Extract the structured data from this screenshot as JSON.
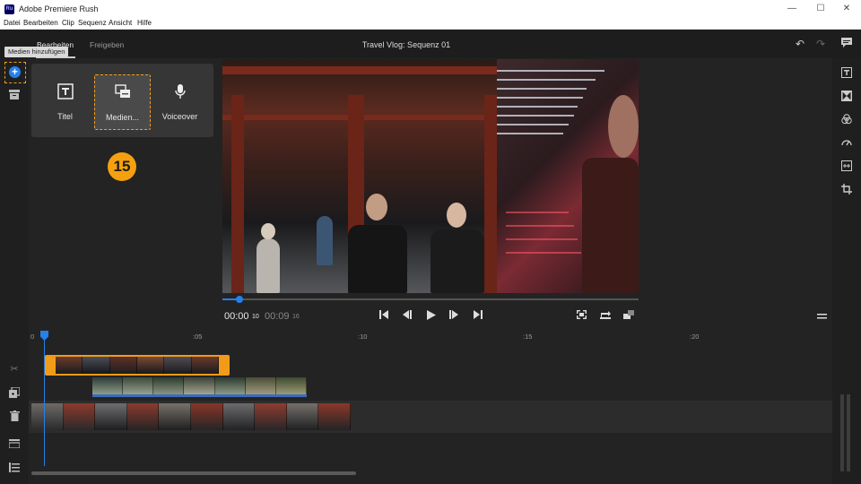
{
  "window": {
    "title": "Adobe Premiere Rush",
    "app_icon_text": "Ru",
    "controls": [
      "—",
      "☐",
      "✕"
    ]
  },
  "menu": [
    "Datei",
    "Bearbeiten",
    "Clip",
    "Sequenz",
    "Ansicht",
    "Hilfe"
  ],
  "header": {
    "tabs": [
      "Bearbeiten",
      "Freigeben"
    ],
    "active_tab": "Bearbeiten",
    "sequence_title": "Travel Vlog: Sequenz 01",
    "icons": [
      "undo-icon",
      "redo-icon",
      "comment-icon"
    ]
  },
  "tooltip": "Medien hinzufügen",
  "add_panel": {
    "options": [
      {
        "label": "Titel",
        "icon": "title-icon"
      },
      {
        "label": "Medien...",
        "icon": "media-icon"
      },
      {
        "label": "Voiceover",
        "icon": "microphone-icon"
      }
    ]
  },
  "step_badge": "15",
  "playback": {
    "current_time": "00:00",
    "current_frames": "10",
    "duration_time": "00:09",
    "duration_frames": "16",
    "progress": 0.04
  },
  "timeline": {
    "ruler_labels": [
      "0",
      ":05",
      ":10",
      ":15",
      ":20"
    ]
  },
  "left_toolbar_icons": [
    "add-icon",
    "project-icon",
    "scissors-icon",
    "duplicate-icon",
    "trash-icon",
    "track-icon",
    "list-icon"
  ],
  "right_toolbar_icons": [
    "text-icon",
    "transition-icon",
    "color-icon",
    "speed-icon",
    "audio-icon",
    "crop-icon"
  ],
  "colors": {
    "accent": "#2680eb",
    "highlight": "#f0a020",
    "background": "#232323"
  }
}
